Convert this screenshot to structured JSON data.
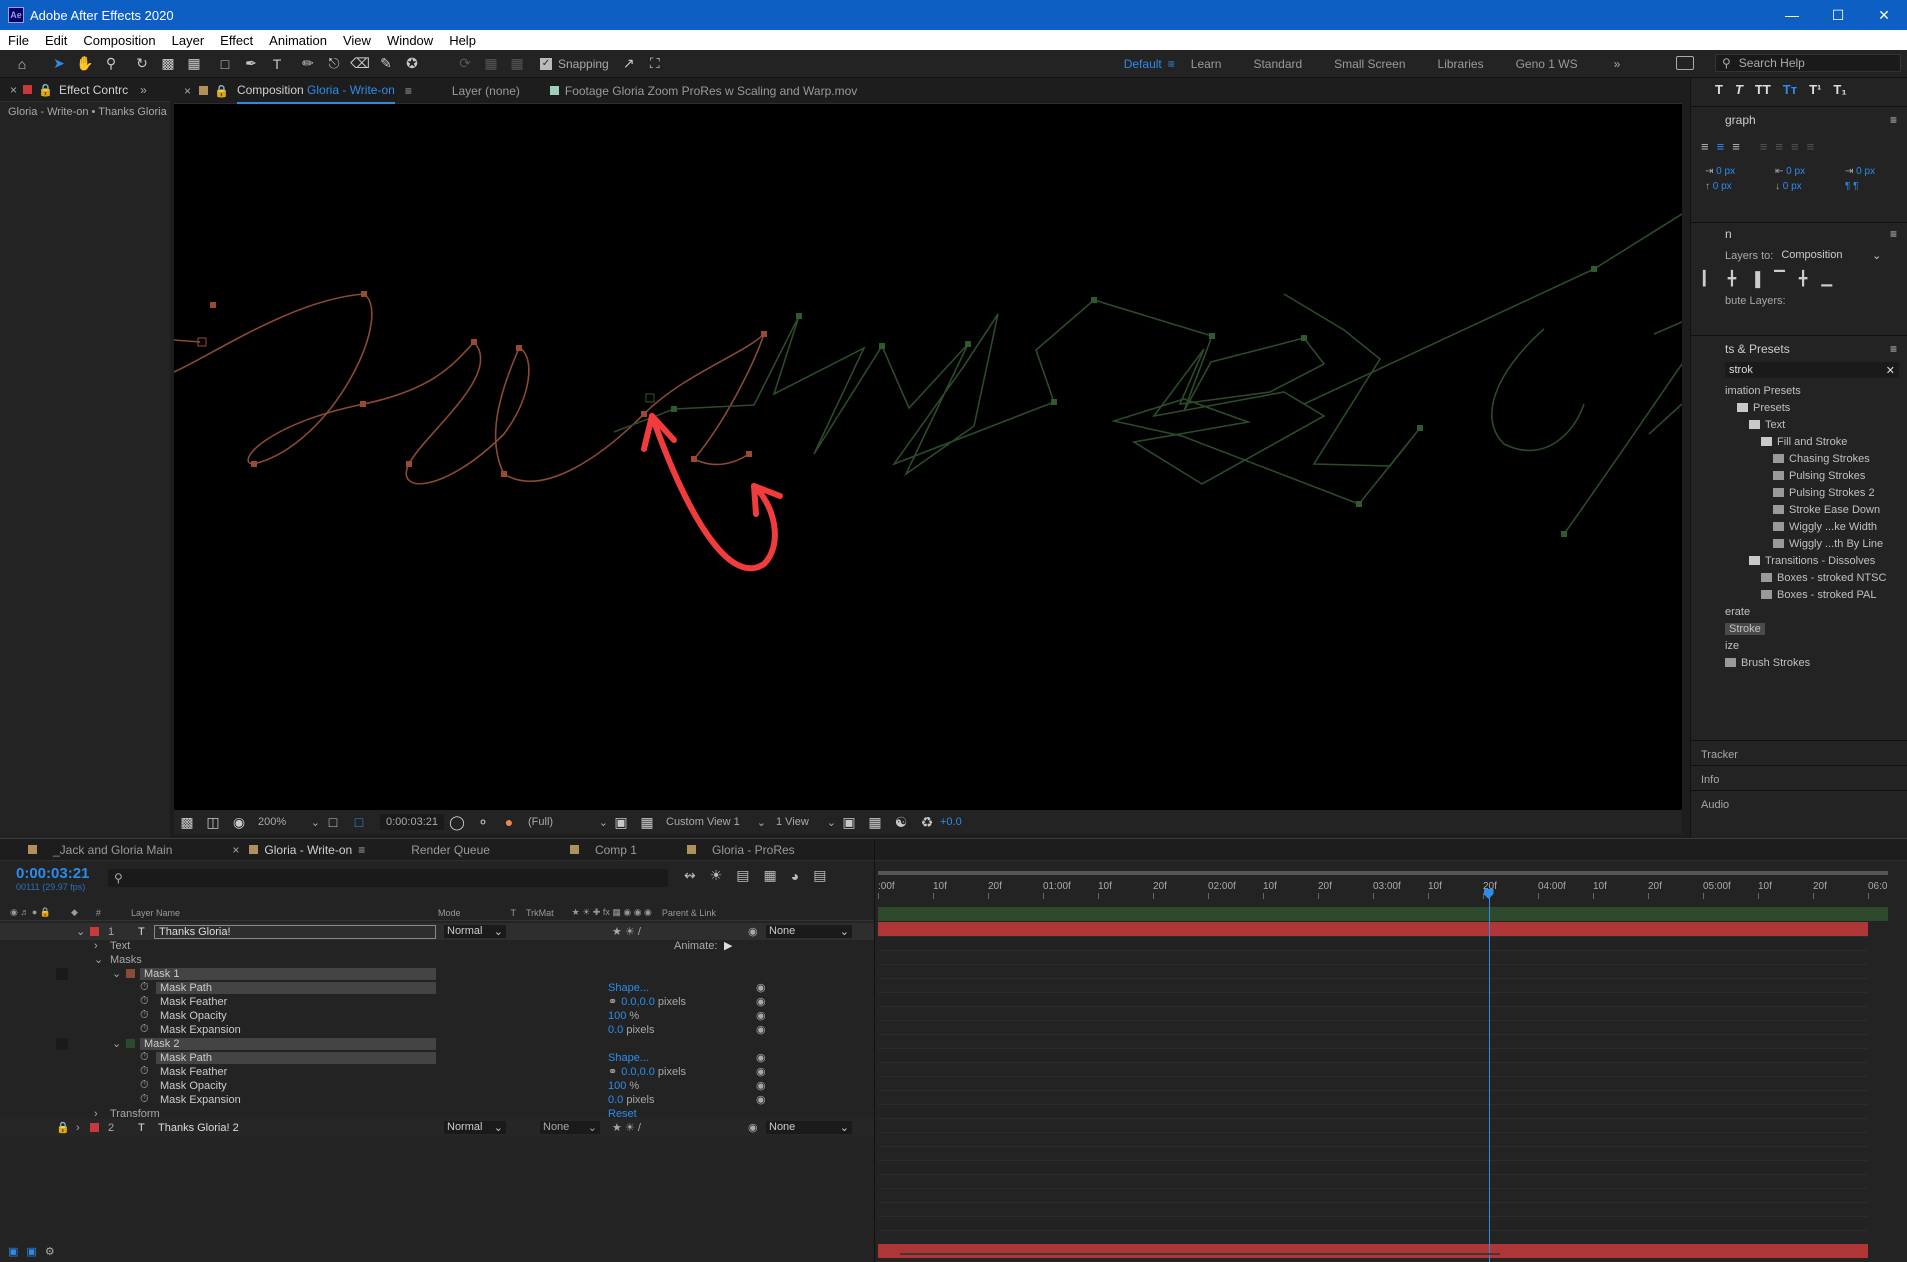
{
  "window": {
    "title": "Adobe After Effects 2020",
    "logo": "Ae"
  },
  "menu": [
    "File",
    "Edit",
    "Composition",
    "Layer",
    "Effect",
    "Animation",
    "View",
    "Window",
    "Help"
  ],
  "toolbar": {
    "snapping_label": "Snapping",
    "workspaces": [
      "Default",
      "Learn",
      "Standard",
      "Small Screen",
      "Libraries",
      "Geno 1 WS"
    ],
    "active_workspace": "Default",
    "search_placeholder": "Search Help"
  },
  "left_panel": {
    "tab": "Effect Contrc",
    "breadcrumb": "Gloria - Write-on • Thanks Gloria"
  },
  "viewer_tabs": {
    "comp_prefix": "Composition",
    "comp_name": "Gloria - Write-on",
    "layer": "Layer (none)",
    "footage_prefix": "Footage",
    "footage_name": "Gloria Zoom ProRes w Scaling and Warp.mov"
  },
  "viewer_bar": {
    "zoom": "200%",
    "timecode": "0:00:03:21",
    "resolution": "(Full)",
    "view": "Custom View 1",
    "views": "1 View",
    "exposure": "+0.0"
  },
  "right_panel": {
    "paragraph_title": "graph",
    "px_values": [
      "0 px",
      "0 px",
      "0 px",
      "0 px",
      "0 px"
    ],
    "align_title": "n",
    "align_to_label": "Layers to:",
    "align_to_value": "Composition",
    "distribute_label": "bute Layers:",
    "effects_title": "ts & Presets",
    "search_value": "strok",
    "tree": [
      {
        "label": "imation Presets",
        "indent": 0,
        "kind": "text"
      },
      {
        "label": "Presets",
        "indent": 1,
        "kind": "folder"
      },
      {
        "label": "Text",
        "indent": 2,
        "kind": "folder"
      },
      {
        "label": "Fill and Stroke",
        "indent": 3,
        "kind": "folder"
      },
      {
        "label": "Chasing Strokes",
        "indent": 4,
        "kind": "preset"
      },
      {
        "label": "Pulsing Strokes",
        "indent": 4,
        "kind": "preset"
      },
      {
        "label": "Pulsing Strokes 2",
        "indent": 4,
        "kind": "preset"
      },
      {
        "label": "Stroke Ease Down",
        "indent": 4,
        "kind": "preset"
      },
      {
        "label": "Wiggly ...ke Width",
        "indent": 4,
        "kind": "preset"
      },
      {
        "label": "Wiggly ...th By Line",
        "indent": 4,
        "kind": "preset"
      },
      {
        "label": "Transitions - Dissolves",
        "indent": 2,
        "kind": "folder"
      },
      {
        "label": "Boxes - stroked NTSC",
        "indent": 3,
        "kind": "preset"
      },
      {
        "label": "Boxes - stroked PAL",
        "indent": 3,
        "kind": "preset"
      },
      {
        "label": "erate",
        "indent": 0,
        "kind": "text"
      },
      {
        "label": "Stroke",
        "indent": 0,
        "kind": "selected"
      },
      {
        "label": "ize",
        "indent": 0,
        "kind": "text"
      },
      {
        "label": "Brush Strokes",
        "indent": 0,
        "kind": "preset"
      }
    ],
    "collapsed_panels": [
      "Tracker",
      "Info",
      "Audio"
    ]
  },
  "timeline": {
    "tabs": [
      "_Jack and Gloria Main",
      "Gloria - Write-on",
      "Render Queue",
      "Comp 1",
      "Gloria - ProRes"
    ],
    "active_tab": "Gloria - Write-on",
    "timecode": "0:00:03:21",
    "frame_info": "00111 (29.97 fps)",
    "columns": {
      "layer_name": "Layer Name",
      "mode": "Mode",
      "t": "T",
      "trkmat": "TrkMat",
      "parent": "Parent & Link"
    },
    "ruler": [
      ":00f",
      "10f",
      "20f",
      "01:00f",
      "10f",
      "20f",
      "02:00f",
      "10f",
      "20f",
      "03:00f",
      "10f",
      "20f",
      "04:00f",
      "10f",
      "20f",
      "05:00f",
      "10f",
      "20f",
      "06:0"
    ],
    "playhead_seconds": 3.7,
    "duration_seconds": 6.0,
    "animate_label": "Animate:",
    "layers": [
      {
        "num": "1",
        "name": "Thanks Gloria!",
        "mode": "Normal",
        "parent": "None"
      },
      {
        "num": "2",
        "name": "Thanks Gloria! 2",
        "mode": "Normal",
        "trkmat": "None",
        "parent": "None"
      }
    ],
    "text_group": "Text",
    "masks_group": "Masks",
    "masks": [
      {
        "name": "Mask 1",
        "props": [
          {
            "label": "Mask Path",
            "value": "Shape...",
            "unit": ""
          },
          {
            "label": "Mask Feather",
            "value": "0.0,0.0",
            "unit": "pixels"
          },
          {
            "label": "Mask Opacity",
            "value": "100",
            "unit": "%"
          },
          {
            "label": "Mask Expansion",
            "value": "0.0",
            "unit": "pixels"
          }
        ]
      },
      {
        "name": "Mask 2",
        "props": [
          {
            "label": "Mask Path",
            "value": "Shape...",
            "unit": ""
          },
          {
            "label": "Mask Feather",
            "value": "0.0,0.0",
            "unit": "pixels"
          },
          {
            "label": "Mask Opacity",
            "value": "100",
            "unit": "%"
          },
          {
            "label": "Mask Expansion",
            "value": "0.0",
            "unit": "pixels"
          }
        ]
      }
    ],
    "transform_label": "Transform",
    "transform_value": "Reset"
  },
  "colors": {
    "accent": "#2d8ceb",
    "label_red": "#c8393b",
    "mask1": "#8a4a34",
    "mask2": "#2c4a2c",
    "annotation": "#f03c3c"
  }
}
